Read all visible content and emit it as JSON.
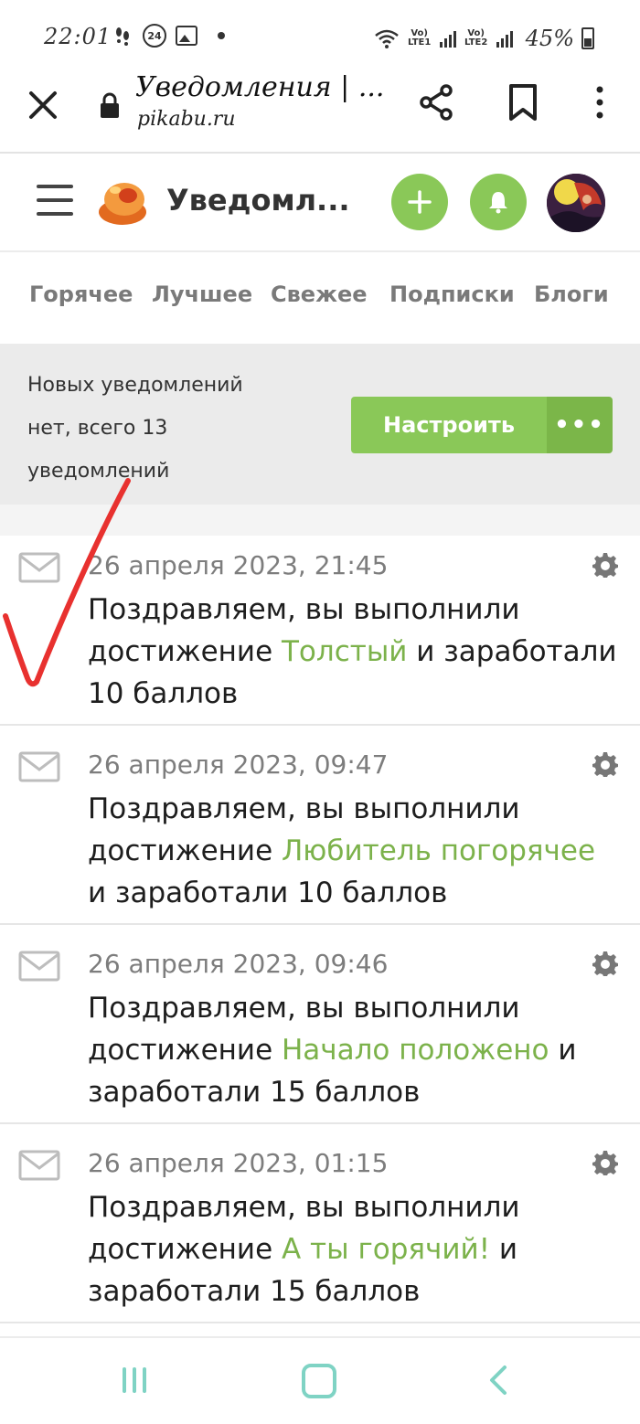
{
  "status_bar": {
    "time": "22:01",
    "badge": "24",
    "lte1": "Vo) LTE1",
    "lte2": "Vo) LTE2",
    "battery": "45%"
  },
  "browser": {
    "title": "Уведомления | ...",
    "url": "pikabu.ru"
  },
  "header": {
    "title": "Уведомл..."
  },
  "nav": {
    "tabs": [
      "Горячее",
      "Лучшее",
      "Свежее",
      "Подписки",
      "Блоги"
    ]
  },
  "banner": {
    "text": "Новых уведомлений нет, всего 13 уведомлений",
    "button": "Настроить",
    "more": "•••"
  },
  "notifications": [
    {
      "date": "26 апреля 2023, 21:45",
      "prefix": "Поздравляем, вы выполнили достижение ",
      "achievement": "Толстый",
      "suffix": " и заработали 10 баллов"
    },
    {
      "date": "26 апреля 2023, 09:47",
      "prefix": "Поздравляем, вы выполнили достижение ",
      "achievement": "Любитель погорячее",
      "suffix": " и заработали 10 баллов"
    },
    {
      "date": "26 апреля 2023, 09:46",
      "prefix": "Поздравляем, вы выполнили достижение ",
      "achievement": "Начало положено",
      "suffix": " и заработали 15 баллов"
    },
    {
      "date": "26 апреля 2023, 01:15",
      "prefix": "Поздравляем, вы выполнили достижение ",
      "achievement": "А ты горячий!",
      "suffix": " и заработали 15 баллов"
    }
  ],
  "colors": {
    "accent_green": "#8ac858",
    "achievement_green": "#7cb24b",
    "annotation_red": "#e8312f"
  }
}
